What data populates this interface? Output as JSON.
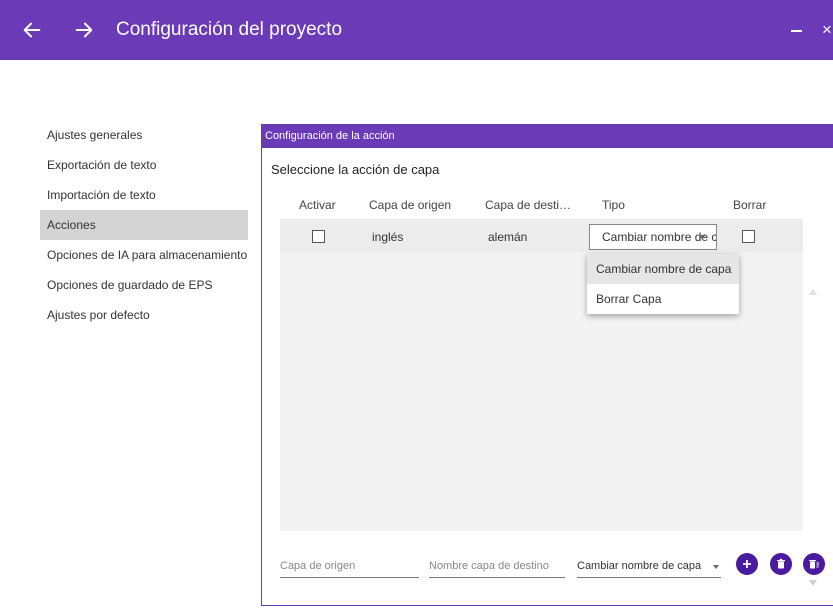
{
  "window": {
    "title": "Configuración del proyecto",
    "close_glyph": "×"
  },
  "sidebar": {
    "items": [
      {
        "label": "Ajustes generales"
      },
      {
        "label": "Exportación de texto"
      },
      {
        "label": "Importación de texto"
      },
      {
        "label": "Acciones",
        "active": true
      },
      {
        "label": "Opciones de IA para almacenamiento"
      },
      {
        "label": "Opciones de guardado de EPS"
      },
      {
        "label": "Ajustes por defecto"
      }
    ]
  },
  "panel": {
    "header": "Configuración de la acción",
    "subtitle": "Seleccione la acción de capa",
    "table": {
      "columns": [
        "Activar",
        "Capa de origen",
        "Capa de desti…",
        "Tipo",
        "Borrar"
      ],
      "rows": [
        {
          "activar": false,
          "origen": "inglés",
          "destino": "alemán",
          "tipo": "Cambiar nombre de capa",
          "borrar": false
        }
      ]
    },
    "dropdown_options": [
      "Cambiar nombre de capa",
      "Borrar Capa"
    ],
    "bottom": {
      "origen_placeholder": "Capa de origen",
      "destino_placeholder": "Nombre capa de destino",
      "tipo_value": "Cambiar nombre de capa"
    }
  },
  "colors": {
    "accent": "#6a3ab7",
    "button": "#4a1aa0",
    "selected_row": "#d4d4d4"
  },
  "icons": [
    "arrow-left-icon",
    "arrow-right-icon",
    "minimize-icon",
    "close-icon",
    "add-icon",
    "delete-icon",
    "delete-all-icon"
  ]
}
